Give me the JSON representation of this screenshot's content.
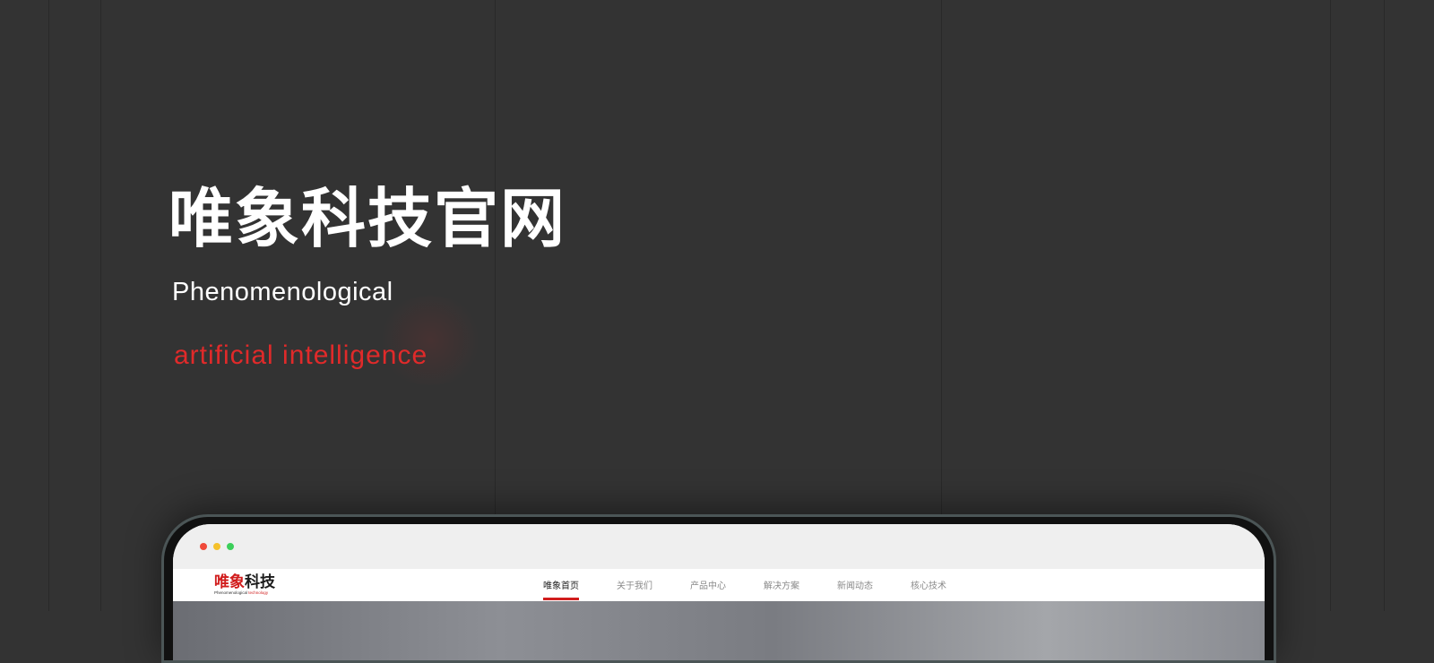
{
  "hero": {
    "title": "唯象科技官网",
    "subtitle": "Phenomenological",
    "accent": "artificial intelligence"
  },
  "colors": {
    "background": "#333333",
    "accent": "#e02a2a",
    "brand_red": "#d11d1d",
    "device_bezel": "#4b5556"
  },
  "browser": {
    "window_controls": [
      {
        "name": "close",
        "color": "#f04a3a"
      },
      {
        "name": "minimize",
        "color": "#f5c12b"
      },
      {
        "name": "maximize",
        "color": "#3ccf5a"
      }
    ]
  },
  "site": {
    "logo": {
      "main_red": "唯象",
      "main_dark": "科技",
      "tagline_dark": "Phenomenological",
      "tagline_red": "technology"
    },
    "nav": [
      {
        "label": "唯象首页",
        "active": true
      },
      {
        "label": "关于我们",
        "active": false
      },
      {
        "label": "产品中心",
        "active": false
      },
      {
        "label": "解决方案",
        "active": false
      },
      {
        "label": "新闻动态",
        "active": false
      },
      {
        "label": "核心技术",
        "active": false
      }
    ]
  }
}
